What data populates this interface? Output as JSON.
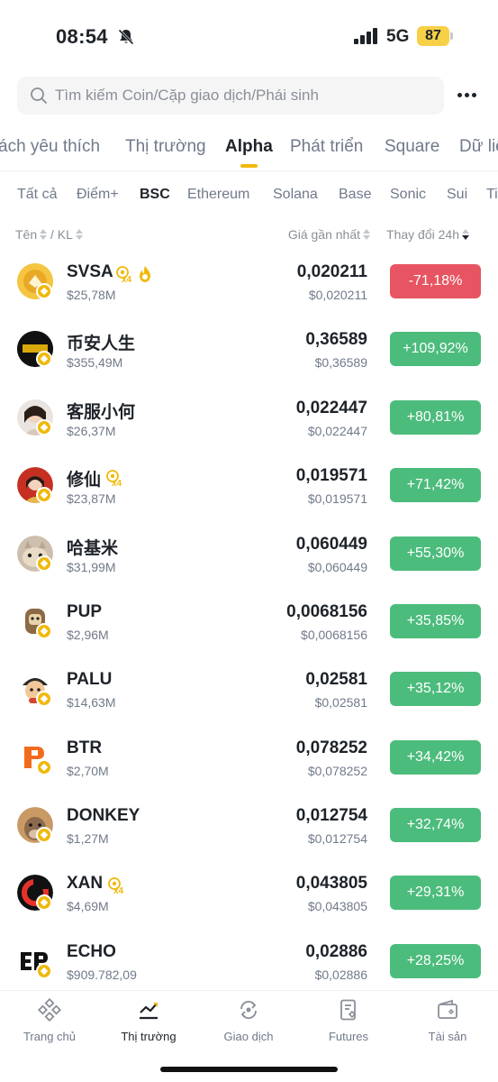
{
  "status": {
    "time": "08:54",
    "network": "5G",
    "battery": "87"
  },
  "search": {
    "placeholder": "Tìm kiếm Coin/Cặp giao dịch/Phái sinh"
  },
  "main_tabs": [
    {
      "label": "ách yêu thích"
    },
    {
      "label": "Thị trường"
    },
    {
      "label": "Alpha"
    },
    {
      "label": "Phát triển"
    },
    {
      "label": "Square"
    },
    {
      "label": "Dữ liệ"
    }
  ],
  "chain_tabs": [
    {
      "label": "Tất cả"
    },
    {
      "label": "Điểm+"
    },
    {
      "label": "BSC"
    },
    {
      "label": "Ethereum"
    },
    {
      "label": "Solana"
    },
    {
      "label": "Base"
    },
    {
      "label": "Sonic"
    },
    {
      "label": "Sui"
    },
    {
      "label": "Ti"
    }
  ],
  "header": {
    "name": "Tên",
    "sep": "/",
    "vol": "KL",
    "price": "Giá gần nhất",
    "change": "Thay đổi 24h"
  },
  "tokens": [
    {
      "symbol": "SVSA",
      "volume": "$25,78M",
      "price": "0,020211",
      "price_usd": "$0,020211",
      "change": "-71,18%",
      "direction": "down",
      "x4": "x4",
      "fire": true
    },
    {
      "symbol": "币安人生",
      "volume": "$355,49M",
      "price": "0,36589",
      "price_usd": "$0,36589",
      "change": "+109,92%",
      "direction": "up"
    },
    {
      "symbol": "客服小何",
      "volume": "$26,37M",
      "price": "0,022447",
      "price_usd": "$0,022447",
      "change": "+80,81%",
      "direction": "up"
    },
    {
      "symbol": "修仙",
      "volume": "$23,87M",
      "price": "0,019571",
      "price_usd": "$0,019571",
      "change": "+71,42%",
      "direction": "up",
      "x4": "x4"
    },
    {
      "symbol": "哈基米",
      "volume": "$31,99M",
      "price": "0,060449",
      "price_usd": "$0,060449",
      "change": "+55,30%",
      "direction": "up"
    },
    {
      "symbol": "PUP",
      "volume": "$2,96M",
      "price": "0,0068156",
      "price_usd": "$0,0068156",
      "change": "+35,85%",
      "direction": "up"
    },
    {
      "symbol": "PALU",
      "volume": "$14,63M",
      "price": "0,02581",
      "price_usd": "$0,02581",
      "change": "+35,12%",
      "direction": "up"
    },
    {
      "symbol": "BTR",
      "volume": "$2,70M",
      "price": "0,078252",
      "price_usd": "$0,078252",
      "change": "+34,42%",
      "direction": "up"
    },
    {
      "symbol": "DONKEY",
      "volume": "$1,27M",
      "price": "0,012754",
      "price_usd": "$0,012754",
      "change": "+32,74%",
      "direction": "up"
    },
    {
      "symbol": "XAN",
      "volume": "$4,69M",
      "price": "0,043805",
      "price_usd": "$0,043805",
      "change": "+29,31%",
      "direction": "up",
      "x4": "x4"
    },
    {
      "symbol": "ECHO",
      "volume": "$909.782,09",
      "price": "0,02886",
      "price_usd": "$0,02886",
      "change": "+28,25%",
      "direction": "up"
    }
  ],
  "colors": {
    "up": "#4cbc7c",
    "down": "#e65561",
    "accent": "#f0b90b"
  },
  "bottom_nav": [
    {
      "label": "Trang chủ",
      "icon": "binance-home-icon"
    },
    {
      "label": "Thị trường",
      "icon": "market-chart-icon"
    },
    {
      "label": "Giao dịch",
      "icon": "trade-swap-icon"
    },
    {
      "label": "Futures",
      "icon": "futures-doc-icon"
    },
    {
      "label": "Tài sản",
      "icon": "wallet-icon"
    }
  ]
}
